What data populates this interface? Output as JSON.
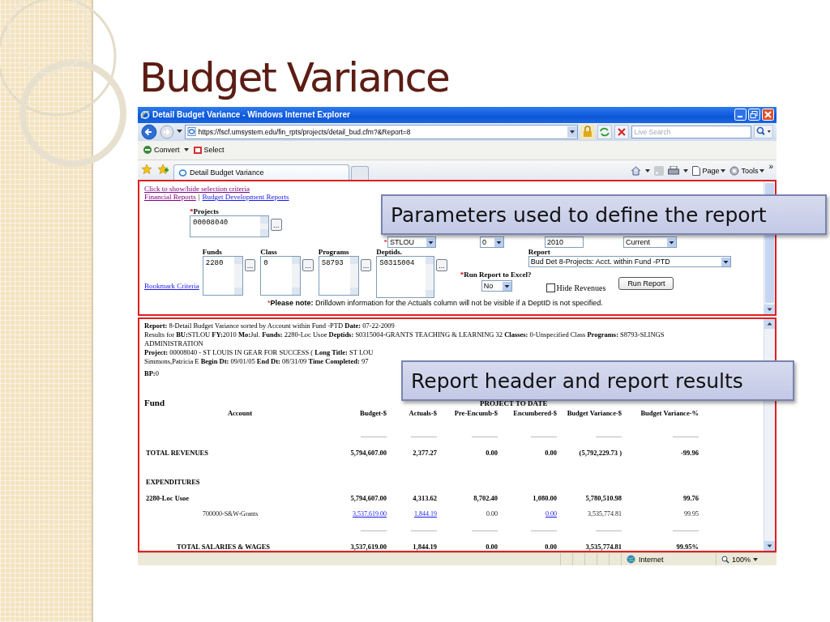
{
  "slide": {
    "title": "Budget Variance"
  },
  "browser": {
    "title": "Detail Budget Variance - Windows Internet Explorer",
    "address": "https://fscf.umsystem.edu/fin_rpts/projects/detail_bud.cfm?&Report=8",
    "search_placeholder": "Live Search",
    "command_bar": [
      "Convert",
      "Select"
    ],
    "tabs": [
      {
        "label": "Detail Budget Variance",
        "selected": true
      }
    ],
    "tools": [
      "Page",
      "Tools"
    ],
    "overflow": "»",
    "status": {
      "zone": "Internet",
      "zoom": "100%"
    }
  },
  "criteria": {
    "toggle_link": {
      "text": "Click to show/hide selection criteria",
      "visited": true
    },
    "nav": [
      {
        "text": "Financial Reports",
        "visited": true
      },
      {
        "text": "Budget Development Reports",
        "visited": false
      }
    ],
    "nav_separator": "|",
    "projects": {
      "mark": "*",
      "label": "Projects",
      "value": "00008040",
      "button": "..."
    },
    "period": {
      "mark": "*",
      "fields": [
        {
          "value": "STLOU",
          "kind": "select"
        },
        {
          "value": "0",
          "kind": "select"
        },
        {
          "value": "2010",
          "kind": "input"
        },
        {
          "value": "Current",
          "kind": "select"
        }
      ]
    },
    "lists": [
      {
        "label": "Funds",
        "value": "2280",
        "button": "..."
      },
      {
        "label": "Class",
        "value": "0",
        "button": "..."
      },
      {
        "label": "Programs",
        "value": "S8793",
        "button": "..."
      },
      {
        "label": "Deptids.",
        "value": "S0315004",
        "button": "..."
      }
    ],
    "bookmark": "Bookmark Criteria",
    "report_select": {
      "label": "Report",
      "value": "Bud Det 8-Projects: Acct. within Fund -PTD"
    },
    "excel": {
      "mark": "*",
      "label": "Run Report to Excel?",
      "value": "No"
    },
    "hide_revenues": {
      "label": "Hide Revenues",
      "checked": false
    },
    "run_button": "Run Report",
    "note": {
      "mark": "*",
      "text": "**Please note:** Drilldown information for the Actuals column will not be visible if a DeptID is not specified."
    }
  },
  "report": {
    "header": [
      "**Report:** 8-Detail Budget Variance sorted by Account within Fund -PTD **Date:** 07-22-2009",
      "Results for **BU:**STLOU **FY:**2010 **Mo:**Jul. **Funds:** 2280-Loc Usoe **Deptids:** S0315004-GRANTS TEACHING & LEARNING 32 **Classes:** 0-Unspecified Class **Programs:** S8793-SLINGS ADMINISTRATION",
      "**Project:** 00008040 - ST LOUIS IN GEAR FOR SUCCESS ( **Long Title:** ST LOU",
      "Simmons,Patricia E **Begin Dt:** 09/01/05 **End Dt:** 08/31/09 **Time Completed:** 97",
      "**BP:**0"
    ],
    "fund_label": "Fund",
    "period_heading": "PROJECT TO DATE",
    "columns": [
      "Account",
      "Budget-$",
      "Actuals-$",
      "Pre-Encumb-$",
      "Encumbered-$",
      "Budget Variance-$",
      "Budget Variance-%"
    ],
    "rows": [
      {
        "kind": "rule",
        "cells": [
          {
            "text": "----------------"
          },
          {
            "text": "----------------"
          },
          {
            "text": "----------------"
          },
          {
            "text": "----------------"
          },
          {
            "text": "----------------"
          },
          {
            "text": "----------------"
          }
        ]
      },
      {
        "kind": "total",
        "cells": [
          {
            "text": "TOTAL REVENUES"
          },
          {
            "text": "5,794,607.00"
          },
          {
            "text": "2,377.27"
          },
          {
            "text": "0.00"
          },
          {
            "text": "0.00"
          },
          {
            "text": "(5,792,229.73 )"
          },
          {
            "text": "-99.96"
          }
        ]
      },
      {
        "kind": "section",
        "cells": [
          {
            "text": "EXPENDITURES"
          }
        ]
      },
      {
        "kind": "total",
        "cells": [
          {
            "text": "2280-Loc Usoe"
          },
          {
            "text": "5,794,607.00"
          },
          {
            "text": "4,313.62"
          },
          {
            "text": "8,702.40"
          },
          {
            "text": "1,080.00"
          },
          {
            "text": "5,780,510.98"
          },
          {
            "text": "99.76"
          }
        ]
      },
      {
        "kind": "detail",
        "cells": [
          {
            "text": "700000-S&W-Grants"
          },
          {
            "text": "3,537,619.00",
            "link": true
          },
          {
            "text": "1,844.19",
            "link": true
          },
          {
            "text": "0.00"
          },
          {
            "text": "0.00",
            "link": true
          },
          {
            "text": "3,535,774.81"
          },
          {
            "text": "99.95"
          }
        ]
      },
      {
        "kind": "rule",
        "cells": [
          {
            "text": "----------------"
          },
          {
            "text": "----------------"
          },
          {
            "text": "----------------"
          },
          {
            "text": "----------------"
          },
          {
            "text": "----------------"
          },
          {
            "text": "----------------"
          }
        ]
      },
      {
        "kind": "subtotal",
        "cells": [
          {
            "text": "TOTAL SALARIES & WAGES"
          },
          {
            "text": "3,537,619.00"
          },
          {
            "text": "1,844.19"
          },
          {
            "text": "0.00"
          },
          {
            "text": "0.00"
          },
          {
            "text": "3,535,774.81"
          },
          {
            "text": "99.95%"
          }
        ]
      }
    ]
  },
  "callouts": [
    {
      "text": "Parameters used to define the report"
    },
    {
      "text": "Report header and report results"
    }
  ]
}
